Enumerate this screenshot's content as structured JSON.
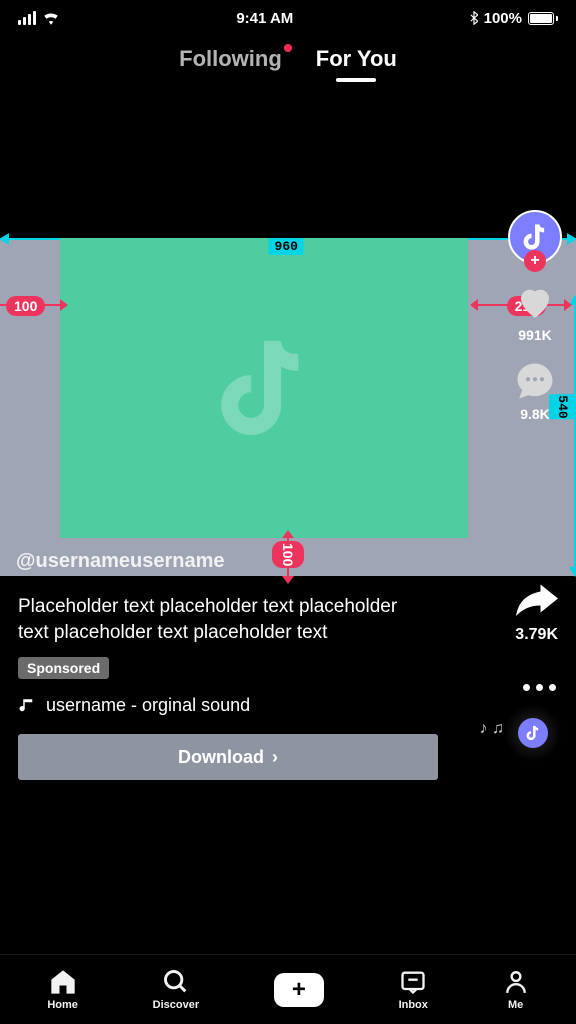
{
  "status": {
    "time": "9:41 AM",
    "battery": "100%"
  },
  "tabs": {
    "following": "Following",
    "for_you": "For You"
  },
  "dimensions": {
    "width": "960",
    "height": "540",
    "margin_left": "100",
    "margin_right": "210",
    "margin_bottom": "100"
  },
  "sidebar": {
    "likes": "991K",
    "comments": "9.8K"
  },
  "post": {
    "username": "@usernameusername",
    "caption": "Placeholder text placeholder text placeholder text placeholder text placeholder text",
    "sponsored": "Sponsored",
    "sound": "username - orginal sound",
    "download": "Download",
    "shares": "3.79K"
  },
  "nav": {
    "home": "Home",
    "discover": "Discover",
    "inbox": "Inbox",
    "me": "Me"
  }
}
